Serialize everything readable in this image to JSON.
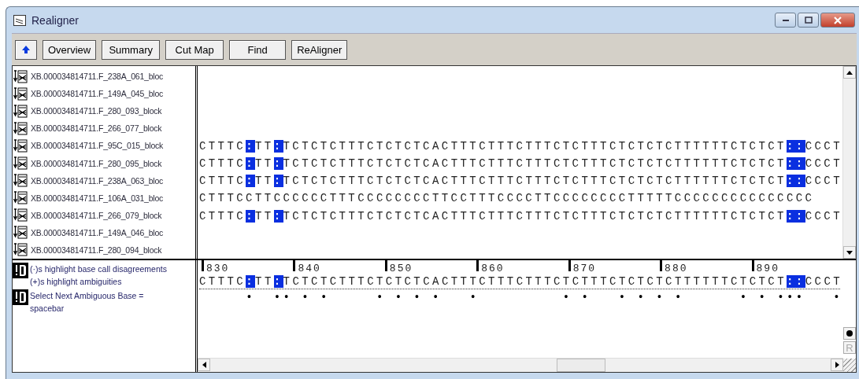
{
  "window": {
    "title": "Realigner"
  },
  "toolbar": {
    "buttons": [
      "Overview",
      "Summary",
      "Cut Map",
      "Find",
      "ReAligner"
    ]
  },
  "reads": [
    {
      "name": "XB.000034814711.F_238A_061_bloc"
    },
    {
      "name": "XB.000034814711.F_149A_045_bloc"
    },
    {
      "name": "XB.000034814711.F_280_093_block"
    },
    {
      "name": "XB.000034814711.F_266_077_block"
    },
    {
      "name": "XB.000034814711.F_95C_015_block",
      "segments": [
        {
          "text": "CTTTC",
          "highlight": false
        },
        {
          "text": ":",
          "highlight": true
        },
        {
          "text": "TT",
          "highlight": false
        },
        {
          "text": ":",
          "highlight": true
        },
        {
          "text": "TCTCTCTTTCTCTCTCACTTTCTTTCTTTCTCTTTCTCTCTCTTTTTTCTCTCT",
          "highlight": false
        },
        {
          "text": "::",
          "highlight": true
        },
        {
          "text": "CCCT",
          "highlight": false
        }
      ]
    },
    {
      "name": "XB.000034814711.F_280_095_block",
      "segments": [
        {
          "text": "CTTTC",
          "highlight": false
        },
        {
          "text": ":",
          "highlight": true
        },
        {
          "text": "TT",
          "highlight": false
        },
        {
          "text": ":",
          "highlight": true
        },
        {
          "text": "TCTCTCTTTCTCTCTCACTTTCTTTCTTTCTCTTTCTCTCTCTTTTTTCTCTCT",
          "highlight": false
        },
        {
          "text": "::",
          "highlight": true
        },
        {
          "text": "CCCT",
          "highlight": false
        }
      ]
    },
    {
      "name": "XB.000034814711.F_238A_063_bloc",
      "segments": [
        {
          "text": "CTTTC",
          "highlight": false
        },
        {
          "text": ":",
          "highlight": true
        },
        {
          "text": "TT",
          "highlight": false
        },
        {
          "text": ":",
          "highlight": true
        },
        {
          "text": "TCTCTCTTTCTCTCTCACTTTCTTTCTTTCTCTTTCTCTCTCTTTTTTCTCTCT",
          "highlight": false
        },
        {
          "text": "::",
          "highlight": true
        },
        {
          "text": "CCCT",
          "highlight": false
        }
      ]
    },
    {
      "name": "XB.000034814711.F_106A_031_bloc",
      "segments": [
        {
          "text": "CTTTCCTTCCCCCCTTTCCCCCCCCTTCCTTTCCCCTTCCCCCCCCTTTTTCCCCCCCCCCCCCCC",
          "highlight": false
        }
      ]
    },
    {
      "name": "XB.000034814711.F_266_079_block",
      "segments": [
        {
          "text": "CTTTC",
          "highlight": false
        },
        {
          "text": ":",
          "highlight": true
        },
        {
          "text": "TT",
          "highlight": false
        },
        {
          "text": ":",
          "highlight": true
        },
        {
          "text": "TCTCTCTTTCTCTCTCACTTTCTTTCTTTCTCTTTCTCTCTCTTTTTTCTCTCT",
          "highlight": false
        },
        {
          "text": "::",
          "highlight": true
        },
        {
          "text": "CCCT",
          "highlight": false
        }
      ]
    },
    {
      "name": "XB.000034814711.F_149A_046_bloc"
    },
    {
      "name": "XB.000034814711.F_280_094_block"
    }
  ],
  "legend": [
    {
      "lines": [
        "(·)s highlight base call disagreements",
        "(+)s highlight ambiguities"
      ]
    },
    {
      "lines": [
        "Select Next Ambiguous Base = spacebar"
      ]
    }
  ],
  "ruler": [
    "830",
    "840",
    "850",
    "860",
    "870",
    "880",
    "890"
  ],
  "consensus": {
    "segments": [
      {
        "text": "CTTTC",
        "highlight": false
      },
      {
        "text": ":",
        "highlight": true
      },
      {
        "text": "TT",
        "highlight": false
      },
      {
        "text": ":",
        "highlight": true
      },
      {
        "text": "TCTCTCTTTCTCTCTCACTTTCTTTCTTTCTCTTTCTCTCTCTTTTTTCTCTCT",
        "highlight": false
      },
      {
        "text": "::",
        "highlight": true
      },
      {
        "text": "CCCT",
        "highlight": false
      }
    ],
    "ambiguity_marks": "     •  •• • •     • • • •   •         • •   • • • •      • • •••   •"
  },
  "side_buttons": [
    "R"
  ]
}
